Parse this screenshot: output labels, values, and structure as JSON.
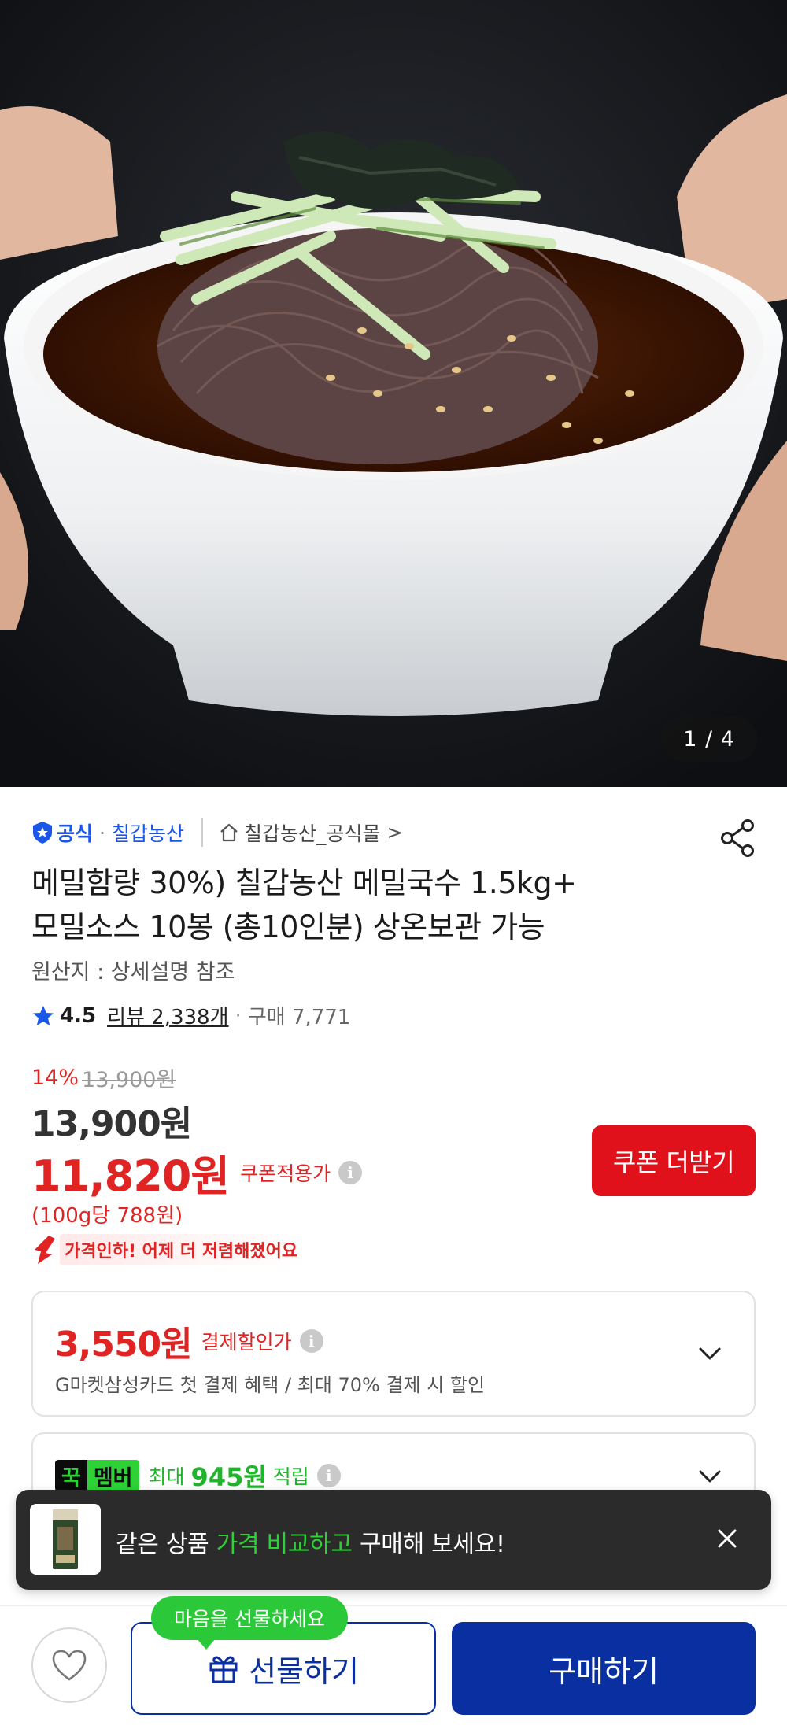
{
  "gallery": {
    "counter": "1 / 4"
  },
  "seller": {
    "official_label": "공식",
    "separator": "·",
    "brand": "칠갑농산",
    "store": "칠갑농산_공식몰",
    "store_chevron": ">"
  },
  "product": {
    "title_line1": "메밀함량 30%) 칠갑농산 메밀국수 1.5kg+",
    "title_line2": "모밀소스 10봉 (총10인분) 상온보관 가능",
    "origin": "원산지 : 상세설명 참조"
  },
  "rating": {
    "score": "4.5",
    "reviews": "리뷰 2,338개",
    "dot": "·",
    "sold": "구매 7,771"
  },
  "price": {
    "discount_rate": "14%",
    "original": "13,900원",
    "sale": "13,900원",
    "coupon_price": "11,820원",
    "coupon_label": "쿠폰적용가",
    "unit_price": "(100g당 788원)",
    "drop_note": "가격인하! 어제 더 저렴해졌어요"
  },
  "coupon_button": "쿠폰 더받기",
  "payment_card": {
    "amount": "3,550원",
    "label": "결제할인가",
    "desc": "G마켓삼성카드 첫 결제 혜택 / 최대 70% 결제 시 할인"
  },
  "member_card": {
    "badge_a": "꾹",
    "badge_b": "멤버",
    "max": "최대",
    "points": "945원",
    "accumulate": "적립"
  },
  "compare_toast": {
    "pre": "같은 상품 ",
    "highlight": "가격 비교하고",
    "post": " 구매해 보세요!"
  },
  "bottom": {
    "gift_bubble": "마음을 선물하세요",
    "gift_label": "선물하기",
    "buy_label": "구매하기"
  },
  "colors": {
    "accent_red": "#e02424",
    "brand_blue": "#0a2fa0",
    "link_blue": "#1a56e8",
    "member_green": "#2ed136"
  }
}
